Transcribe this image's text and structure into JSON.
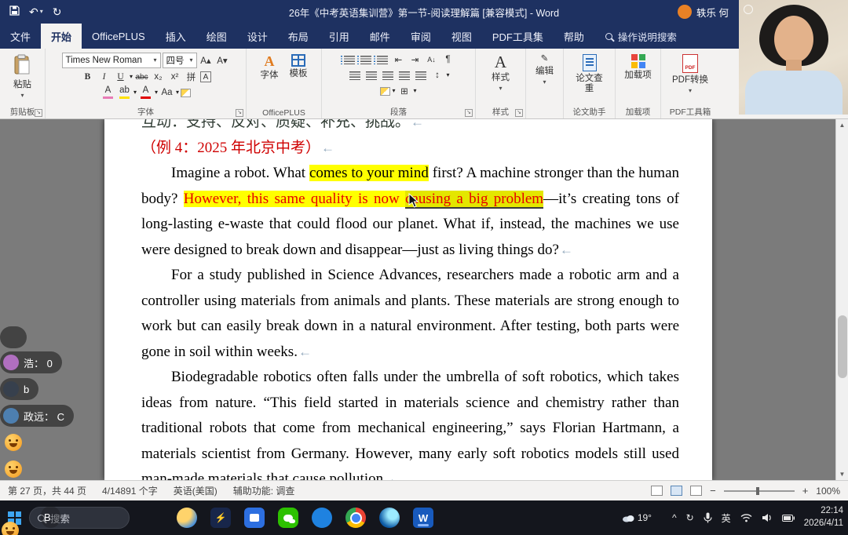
{
  "colors": {
    "titlebar_navy": "#1e3161",
    "ribbon_bg": "#f3f2f1",
    "highlight_yellow": "#ffff00",
    "highlight_red_text": "#e60000",
    "heading_red": "#cf0000",
    "word_blue": "#185abd",
    "wechat_green": "#2dc100"
  },
  "titlebar": {
    "title": "26年《中考英语集训营》第一节-阅读理解篇 [兼容模式] - Word",
    "user": "轶乐 何"
  },
  "tabs": [
    "文件",
    "开始",
    "OfficePLUS",
    "插入",
    "绘图",
    "设计",
    "布局",
    "引用",
    "邮件",
    "审阅",
    "视图",
    "PDF工具集",
    "帮助"
  ],
  "active_tab": "开始",
  "tell_me": "操作说明搜索",
  "icons": {
    "dropdown": "▾",
    "undo": "↶",
    "redo": "↻",
    "grow_font": "A▴",
    "shrink_font": "A▾",
    "bold": "B",
    "italic": "I",
    "underline": "U",
    "strikethrough": "abc",
    "subscript": "x₂",
    "superscript": "x²",
    "clear_format": "A",
    "highlight": "ab",
    "font_color": "A",
    "change_case": "Aa",
    "char_border": "A",
    "phonetic": "拼",
    "indent_decrease": "⇤",
    "indent_increase": "⇥",
    "sort": "A↓",
    "pilcrow": "¶",
    "line_spacing": "↕",
    "borders": "⊞",
    "styles_a": "A",
    "edit_pencil": "✎",
    "scroll_up": "▲",
    "scroll_down": "▼",
    "collapse_ribbon": "˄",
    "minus": "−",
    "plus": "+",
    "chevron_up": "^",
    "sync": "↻",
    "pdf_text": "PDF",
    "word_w": "W",
    "meeting_bolt": "⚡"
  },
  "ribbon": {
    "paste_label": "粘贴",
    "font_name": "Times New Roman",
    "font_size": "四号",
    "groups": {
      "clipboard": "剪贴板",
      "font": "字体",
      "officeplus": "OfficePLUS",
      "paragraph": "段落",
      "styles": "样式",
      "paper_helper": "论文助手",
      "addins": "加载项",
      "pdf_toolbox": "PDF工具箱"
    },
    "buttons": {
      "op_font": "字体",
      "op_template": "模板",
      "styles": "样式",
      "editing": "编辑",
      "paper_check": "论文查重",
      "addins": "加载项",
      "pdf_convert": "PDF转换"
    }
  },
  "document": {
    "pmark": "←",
    "clipped_line": "互动：支持、反对、质疑、补充、挑战。",
    "example_heading": "（例 4：2025 年北京中考）",
    "p1": {
      "s1": "Imagine a robot. What ",
      "s2": "comes to your mind",
      "s3": " first? A machine stronger than the human body? ",
      "s4": "However, this same quality is now ",
      "s5": "causing a big problem",
      "s6": "—it’s creating tons of long-lasting e-waste that could flood our planet. What if, instead, the machines we use were designed to break down and disappear—just as living things do?"
    },
    "p2": "For a study published in Science Advances, researchers made a robotic arm and a controller using materials from animals and plants. These materials are strong enough to work but can easily break down in a natural environment. After testing, both parts were gone in soil within weeks.",
    "p3": "Biodegradable robotics often falls under the umbrella of soft robotics, which takes ideas from nature. “This field started in materials science and chemistry rather than traditional robots that come from mechanical engineering,” says Florian Hartmann, a materials scientist from Germany. However, many early soft robotics models still used man-made materials that cause pollution."
  },
  "statusbar": {
    "page": "第 27 页，共 44 页",
    "words": "4/14891 个字",
    "language": "英语(美国)",
    "accessibility": "辅助功能: 调查",
    "zoom": "100%"
  },
  "taskbar": {
    "search_placeholder": "搜索",
    "temperature": "19°",
    "input_lang": "英",
    "time": "22:14",
    "date": "2026/4/11",
    "apps": [
      "weather",
      "meeting",
      "calendar",
      "wechat",
      "qq",
      "chrome",
      "edge",
      "word"
    ]
  },
  "chat": {
    "items": [
      {
        "text": ""
      },
      {
        "text": "浩： 0"
      },
      {
        "text": "b"
      },
      {
        "text": "政远： C"
      },
      {
        "emoji": "smiley"
      },
      {
        "emoji": "sad"
      },
      {
        "text": "B"
      }
    ]
  }
}
